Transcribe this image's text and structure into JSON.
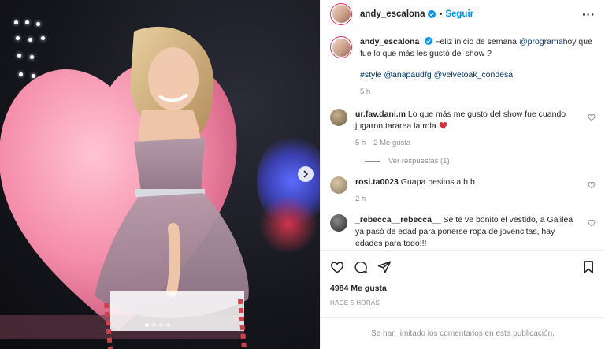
{
  "header": {
    "username": "andy_escalona",
    "separator": "•",
    "follow_label": "Seguir",
    "more_label": "···"
  },
  "caption": {
    "username": "andy_escalona",
    "text_before": "Feliz inicio de semana ",
    "mention": "@programa",
    "text_after": "hoy que fue lo que más les gustó del show ?",
    "tags": [
      "#style",
      "@anapaudfg",
      "@velvetoak_condesa"
    ],
    "time": "5 h"
  },
  "comments": [
    {
      "username": "ur.fav.dani.m",
      "text": "Lo que más me gusto del show fue cuando jugaron tararea la rola",
      "time": "5 h",
      "likes": "2 Me gusta",
      "avatar_color": "#6b5e4a"
    },
    {
      "username": "rosi.ta0023",
      "text": "Guapa besitos a b b",
      "time": "2 h",
      "avatar_color": "#8a7a62"
    },
    {
      "username": "_rebecca__rebecca__",
      "text": "Se te ve bonito el vestido, a Galilea ya pasó de edad para ponerse ropa de jovencitas, hay edades para todo!!!",
      "avatar_color": "#3a3a3a"
    }
  ],
  "replies_label": "Ver respuestas (1)",
  "likes_count": "4984 Me gusta",
  "time_ago": "HACE 5 HORAS",
  "comments_limited": "Se han limitado los comentarios en esta publicación.",
  "colors": {
    "accent": "#0095f6",
    "link": "#00376b",
    "muted": "#8e8e8e",
    "heart_red": "#ed4956"
  },
  "carousel": {
    "total": 4,
    "active": 1
  }
}
